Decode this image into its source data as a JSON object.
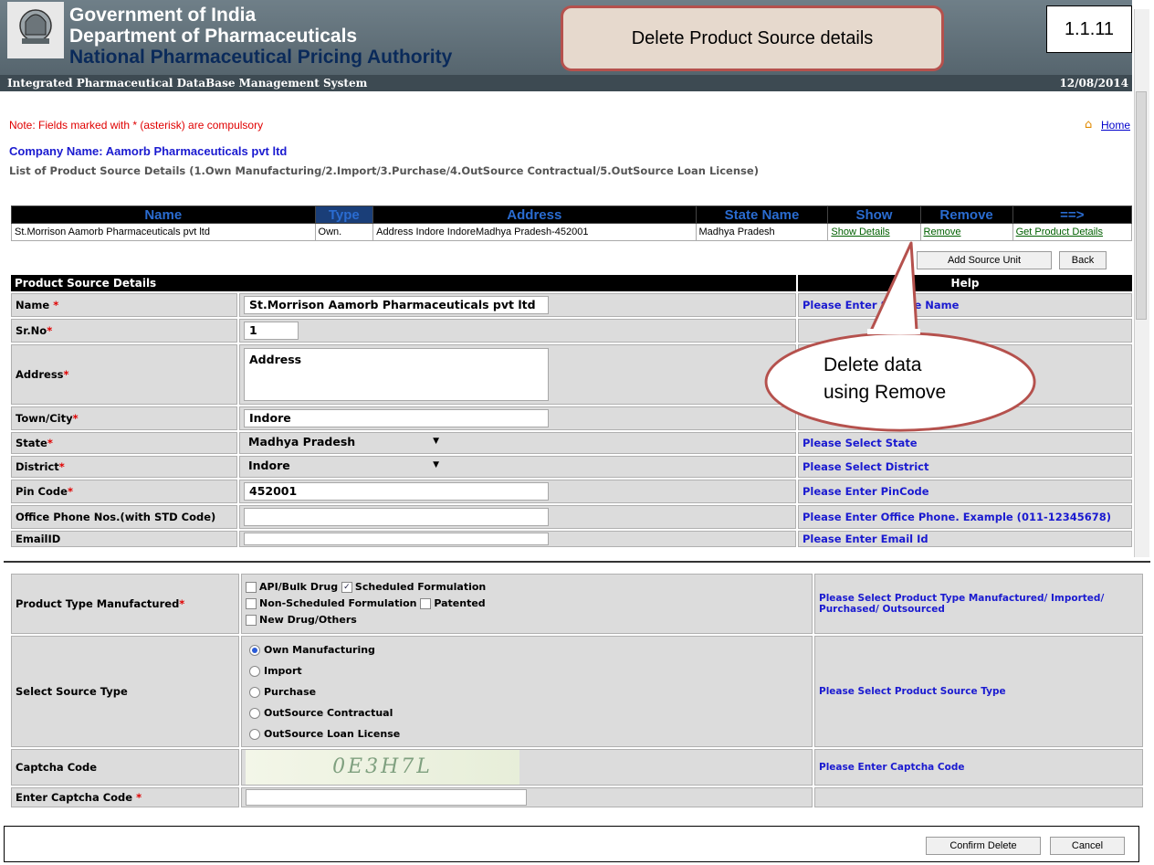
{
  "header": {
    "gov": "Government of India",
    "dept": "Department of Pharmaceuticals",
    "nppa": "National Pharmaceutical Pricing Authority",
    "emblem_caption": "सत्यमेव जयते",
    "system": "Integrated Pharmaceutical DataBase Management System",
    "date": "12/08/2014"
  },
  "annotations": {
    "title": "Delete Product Source details",
    "version": "1.1.11",
    "bubble_line1": "Delete data",
    "bubble_line2": "using Remove"
  },
  "page": {
    "note": "Note: Fields marked with * (asterisk) are compulsory",
    "home": "Home",
    "company": "Company Name: Aamorb Pharmaceuticals pvt ltd",
    "list_title": "List of Product Source Details (1.Own Manufacturing/2.Import/3.Purchase/4.OutSource Contractual/5.OutSource Loan License)"
  },
  "list_table": {
    "headers": [
      "Name",
      "Type",
      "Address",
      "State Name",
      "Show",
      "Remove",
      "==>"
    ],
    "row": {
      "name": "St.Morrison Aamorb Pharmaceuticals pvt ltd",
      "type": "Own.",
      "address": "Address Indore IndoreMadhya Pradesh-452001",
      "state": "Madhya Pradesh",
      "show": "Show Details",
      "remove": "Remove",
      "get": "Get Product Details"
    }
  },
  "actions": {
    "add_source": "Add Source Unit",
    "back": "Back",
    "confirm": "Confirm Delete",
    "cancel": "Cancel"
  },
  "form": {
    "section_title": "Product Source Details",
    "help_title": "Help",
    "name": {
      "label": "Name",
      "value": "St.Morrison Aamorb Pharmaceuticals pvt ltd",
      "help": "Please Enter Source Name"
    },
    "srno": {
      "label": "Sr.No",
      "value": "1"
    },
    "address": {
      "label": "Address",
      "value": "Address"
    },
    "town": {
      "label": "Town/City",
      "value": "Indore"
    },
    "state": {
      "label": "State",
      "value": "Madhya Pradesh",
      "help": "Please Select State"
    },
    "district": {
      "label": "District",
      "value": "Indore",
      "help": "Please Select District"
    },
    "pin": {
      "label": "Pin Code",
      "value": "452001",
      "help": "Please Enter PinCode"
    },
    "phone": {
      "label": "Office Phone Nos.(with STD Code)",
      "value": "",
      "help": "Please Enter Office Phone. Example (011-12345678)"
    },
    "email": {
      "label": "EmailID",
      "value": "",
      "help": "Please Enter Email Id"
    }
  },
  "form2": {
    "ptype": {
      "label": "Product Type Manufactured",
      "opt1": "API/Bulk Drug",
      "opt2": "Scheduled Formulation",
      "opt3": "Non-Scheduled Formulation",
      "opt4": "Patented",
      "opt5": "New Drug/Others",
      "help": "Please Select Product Type Manufactured/ Imported/ Purchased/ Outsourced"
    },
    "stype": {
      "label": "Select Source Type",
      "r1": "Own Manufacturing",
      "r2": "Import",
      "r3": "Purchase",
      "r4": "OutSource Contractual",
      "r5": "OutSource Loan License",
      "help": "Please Select Product Source Type"
    },
    "captcha": {
      "label": "Captcha Code",
      "text": "0E3H7L",
      "help": "Please Enter Captcha Code"
    },
    "captcha_entry": {
      "label": "Enter Captcha Code",
      "value": ""
    }
  }
}
